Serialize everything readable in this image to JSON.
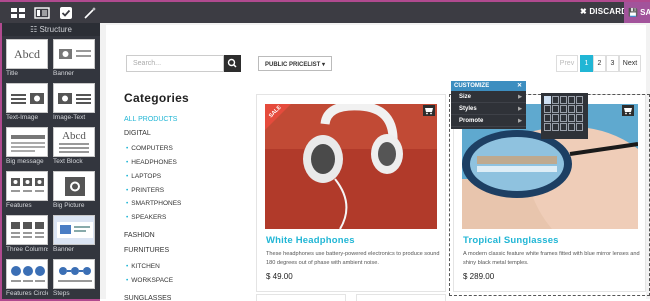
{
  "topbar": {
    "icons": [
      "snippets-icon",
      "theme-icon",
      "options-icon",
      "magic-wand-icon"
    ],
    "discard_label": "✖ DISCARD",
    "save_label": "💾 SAVE"
  },
  "panel": {
    "title": "☷ Structure",
    "snippets": [
      {
        "label": "Title"
      },
      {
        "label": "Banner"
      },
      {
        "label": "Text-Image"
      },
      {
        "label": "Image-Text"
      },
      {
        "label": "Big message"
      },
      {
        "label": "Text Block"
      },
      {
        "label": "Features"
      },
      {
        "label": "Big Picture"
      },
      {
        "label": "Three Columns"
      },
      {
        "label": "Banner"
      },
      {
        "label": "Features Circle"
      },
      {
        "label": "Steps"
      }
    ]
  },
  "shop": {
    "search_placeholder": "Search...",
    "pricelist_label": "PUBLIC PRICELIST ▾",
    "pager": {
      "prev": "Prev",
      "pages": [
        "1",
        "2",
        "3"
      ],
      "next": "Next",
      "active": "1"
    },
    "categories_title": "Categories",
    "categories": [
      {
        "label": "ALL PRODUCTS",
        "level": "top",
        "active": true
      },
      {
        "label": "DIGITAL",
        "level": "top"
      },
      {
        "label": "COMPUTERS",
        "level": "sub"
      },
      {
        "label": "HEADPHONES",
        "level": "sub"
      },
      {
        "label": "LAPTOPS",
        "level": "sub"
      },
      {
        "label": "PRINTERS",
        "level": "sub"
      },
      {
        "label": "SMARTPHONES",
        "level": "sub"
      },
      {
        "label": "SPEAKERS",
        "level": "sub"
      },
      {
        "label": "FASHION",
        "level": "top"
      },
      {
        "label": "FURNITURES",
        "level": "top"
      },
      {
        "label": "KITCHEN",
        "level": "sub"
      },
      {
        "label": "WORKSPACE",
        "level": "sub"
      },
      {
        "label": "SUNGLASSES",
        "level": "top"
      }
    ],
    "products": [
      {
        "name": "White Headphones",
        "ribbon": "SALE",
        "description": "These headphones use battery-powered electronics to produce sound 180 degrees out of phase with ambient noise.",
        "price": "$ 49.00"
      },
      {
        "name": "Tropical Sunglasses",
        "description": "A modern classic feature white frames fitted with blue mirror lenses and shiny black metal temples.",
        "price": "$ 289.00"
      }
    ]
  },
  "customize": {
    "title": "CUSTOMIZE",
    "close": "✕",
    "items": [
      {
        "label": "Size"
      },
      {
        "label": "Styles"
      },
      {
        "label": "Promote"
      }
    ],
    "size_grid": {
      "cols": 5,
      "rows": 4,
      "selected_cols": 1,
      "selected_rows": 1
    }
  },
  "colors": {
    "accent": "#21b6d5",
    "save": "#a2539b",
    "dark": "#3c3c43"
  }
}
